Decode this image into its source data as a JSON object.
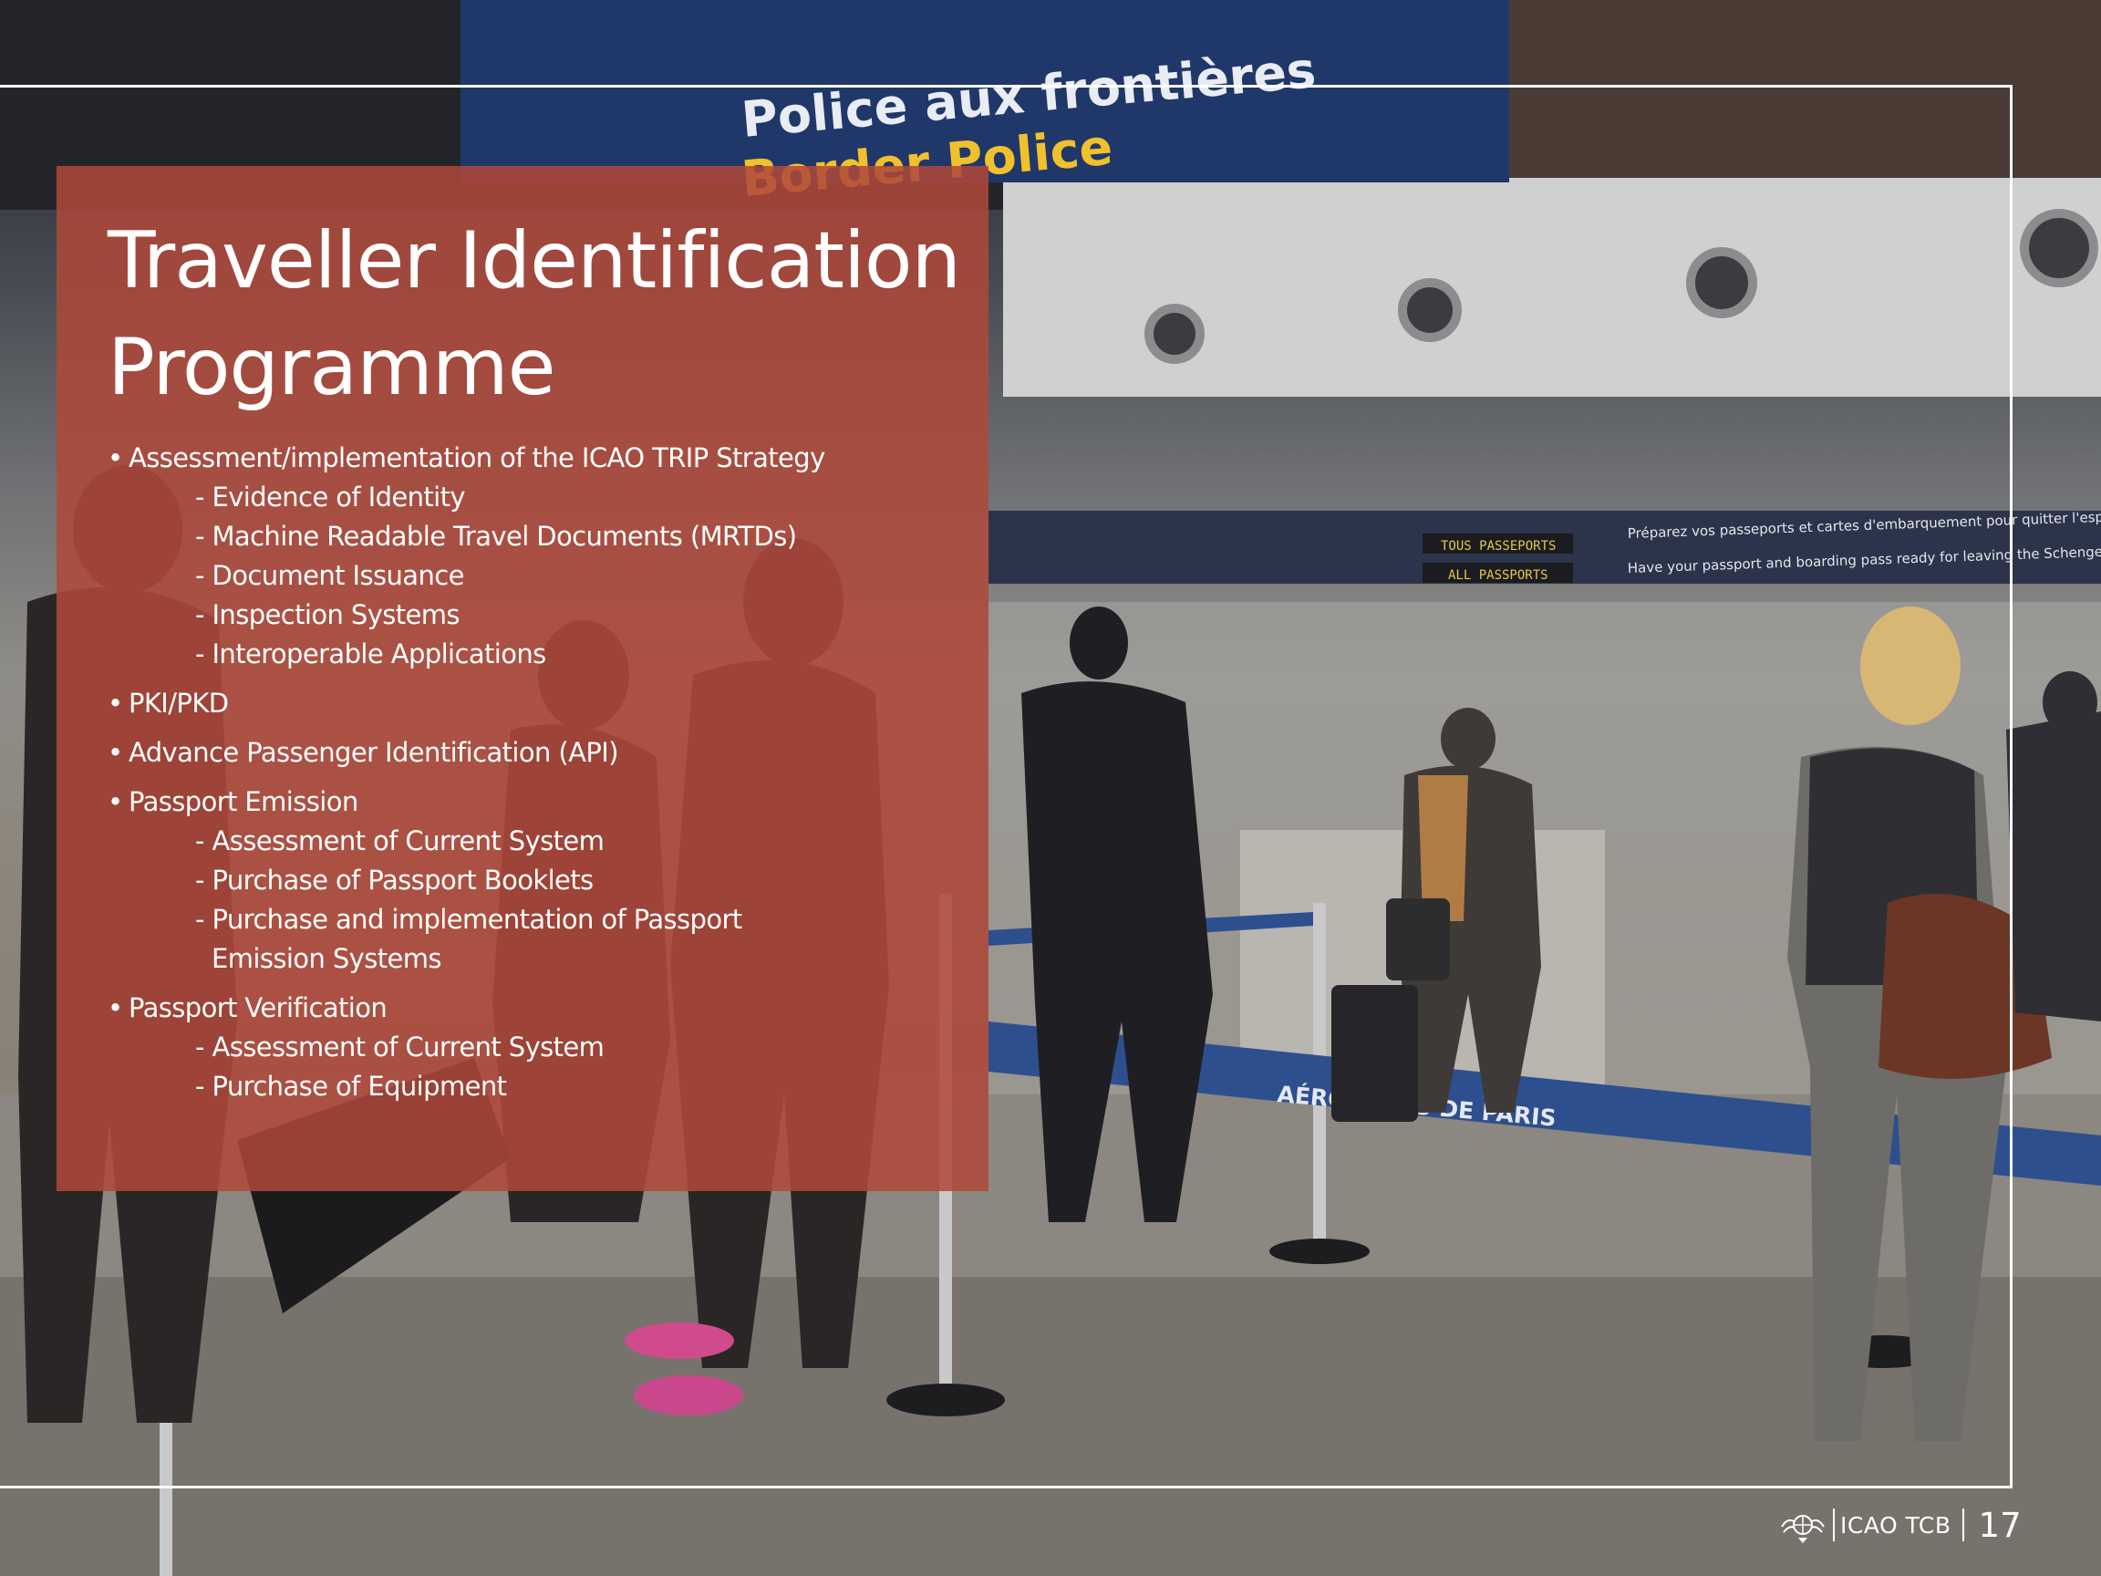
{
  "photo": {
    "signs": {
      "police_fr": "Police aux frontières",
      "police_en": "Border Police",
      "tous_passeports": "TOUS PASSEPORTS",
      "all_passports": "ALL PASSPORTS",
      "schengen_fr": "Préparez vos passeports et cartes d'embarquement pour quitter l'espace Schengen",
      "schengen_en": "Have your passport and boarding pass ready for leaving the Schengen area",
      "belt_text": "AÉROPORTS DE PARIS"
    }
  },
  "slide": {
    "title": "Traveller Identification Programme",
    "sections": [
      {
        "label": "Assessment/implementation of the ICAO TRIP Strategy",
        "items": [
          "- Evidence of Identity",
          "- Machine Readable Travel Documents (MRTDs)",
          "- Document Issuance",
          "- Inspection Systems",
          "- Interoperable Applications"
        ]
      },
      {
        "label": "PKI/PKD",
        "items": []
      },
      {
        "label": "Advance Passenger Identification (API)",
        "items": []
      },
      {
        "label": "Passport Emission",
        "items": [
          "- Assessment of Current System",
          "- Purchase of Passport Booklets",
          "- Purchase and implementation of Passport",
          "Emission Systems"
        ]
      },
      {
        "label": "Passport Verification",
        "items": [
          "- Assessment of Current System",
          "- Purchase of Equipment"
        ]
      }
    ],
    "bullet_char": "•"
  },
  "footer": {
    "org": "ICAO TCB",
    "page_number": "17",
    "emblem_icon": "icao-emblem-icon"
  },
  "colors": {
    "panel": "#b0483a",
    "text": "#ffffff",
    "frame": "#ffffff"
  }
}
